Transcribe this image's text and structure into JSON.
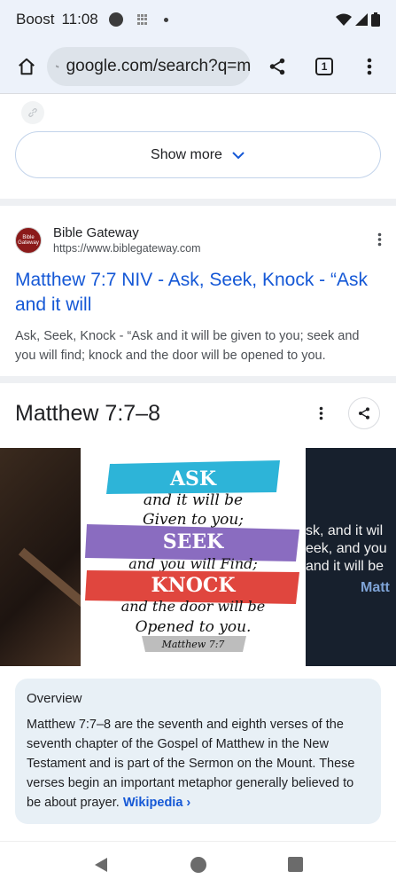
{
  "status_bar": {
    "carrier": "Boost",
    "time": "11:08"
  },
  "browser": {
    "url": "google.com/search?q=m",
    "tab_count": "1"
  },
  "show_more": {
    "label": "Show more"
  },
  "result": {
    "site_name": "Bible Gateway",
    "site_url": "https://www.biblegateway.com",
    "favicon_text": "Bible Gateway",
    "title": "Matthew 7:7 NIV - Ask, Seek, Knock - “Ask and it will",
    "snippet": "Ask, Seek, Knock - “Ask and it will be given to you; seek and you will find; knock and the door will be opened to you."
  },
  "knowledge_panel": {
    "title": "Matthew 7:7–8",
    "image_text": {
      "ask": "ASK",
      "line1": "and it will be",
      "line2": "Given to you;",
      "seek": "SEEK",
      "line3": "and you will Find;",
      "knock": "KNOCK",
      "line4": "and the door will be",
      "line5": "Opened to you.",
      "ref": "Matthew 7:7"
    },
    "right_image_lines": [
      "sk, and it wil",
      "eek, and you",
      "and it will be"
    ],
    "right_image_ref": "Matt",
    "overview_title": "Overview",
    "overview_text": "Matthew 7:7–8 are the seventh and eighth verses of the seventh chapter of the Gospel of Matthew in the New Testament and is part of the Sermon on the Mount. These verses begin an important metaphor generally believed to be about prayer.",
    "overview_link": "Wikipedia ›"
  },
  "colors": {
    "link_blue": "#1558d6",
    "ask_band": "#2db4d8",
    "seek_band": "#8a6cc0",
    "knock_band": "#e0463e"
  }
}
